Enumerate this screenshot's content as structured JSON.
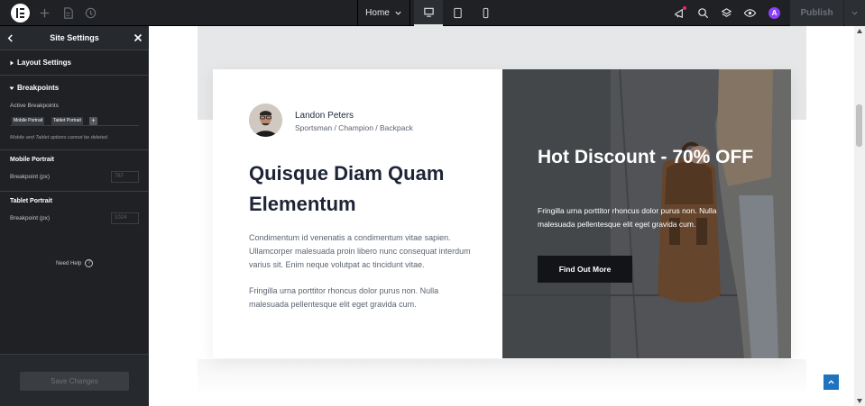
{
  "topbar": {
    "page_name": "Home",
    "publish_label": "Publish",
    "icons": [
      "elementor-logo-icon",
      "add-icon",
      "structure-icon",
      "history-icon",
      "chevron-down-icon",
      "desktop-icon",
      "tablet-icon",
      "mobile-icon",
      "whats-new-icon",
      "search-icon",
      "layers-icon",
      "preview-eye-icon",
      "ai-icon",
      "publish-arrow-icon"
    ]
  },
  "sidebar": {
    "title": "Site Settings",
    "layout_section": "Layout Settings",
    "breakpoints_section": "Breakpoints",
    "active_breakpoints_label": "Active Breakpoints",
    "tags": [
      "Mobile Portrait",
      "Tablet Portrait"
    ],
    "add_tag": "+",
    "note": "Mobile and Tablet options cannot be deleted.",
    "mobile_heading": "Mobile Portrait",
    "mobile_field_label": "Breakpoint (px)",
    "mobile_placeholder": "767",
    "tablet_heading": "Tablet Portrait",
    "tablet_field_label": "Breakpoint (px)",
    "tablet_placeholder": "1024",
    "need_help": "Need Help",
    "help_icon": "?",
    "save_label": "Save Changes"
  },
  "canvas": {
    "author_name": "Landon Peters",
    "author_role": "Sportsman / Champion / Backpack",
    "headline": "Quisque Diam Quam Elementum",
    "para1": "Condimentum id venenatis a condimentum vitae sapien. Ullamcorper malesuada proin libero nunc consequat interdum varius sit. Enim neque volutpat ac tincidunt vitae.",
    "para2": "Fringilla urna porttitor rhoncus dolor purus non. Nulla malesuada pellentesque elit eget gravida cum.",
    "hero_title": "Hot Discount - 70% OFF",
    "hero_text": "Fringilla urna porttitor rhoncus dolor purus non. Nulla malesuada pellentesque elit eget gravida cum.",
    "hero_button": "Find Out More"
  },
  "colors": {
    "topbar_bg": "#1f2124",
    "sidebar_bg": "#1f2124",
    "headline": "#1d2435",
    "button_dark": "#121418",
    "scroll_top": "#1e73be",
    "ai_purple": "#8a3ffc"
  }
}
